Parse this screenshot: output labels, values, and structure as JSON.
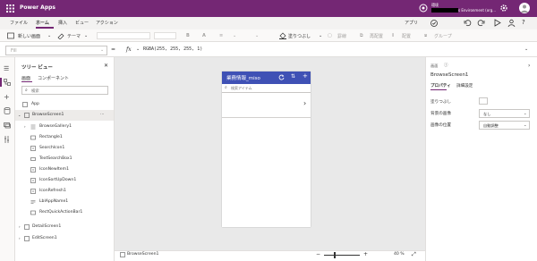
{
  "app": {
    "name": "Power Apps"
  },
  "environment": {
    "label": "環境",
    "name": "s Environment (org..."
  },
  "menu": {
    "items": [
      "ファイル",
      "ホーム",
      "挿入",
      "ビュー",
      "アクション"
    ],
    "right_label": "アプリ"
  },
  "toolbar": {
    "new_screen": "新しい画面",
    "theme": "テーマ",
    "fill": "塗りつぶし",
    "border": "罫線",
    "reorder": "再配置",
    "align": "配置",
    "group": "グループ"
  },
  "formula": {
    "property": "Fill",
    "fx": "fx",
    "value": "RGBA(255, 255, 255, 1)"
  },
  "tree": {
    "title": "ツリー ビュー",
    "tabs": [
      "画面",
      "コンポーネント"
    ],
    "search_placeholder": "検索",
    "app_label": "App",
    "nodes": [
      {
        "label": "BrowseScreen1",
        "icon": "screen-icon"
      },
      {
        "label": "BrowseGallery1",
        "icon": "gallery-icon"
      },
      {
        "label": "Rectangle1",
        "icon": "rectangle-icon"
      },
      {
        "label": "SearchIcon1",
        "icon": "icon-control-icon"
      },
      {
        "label": "TextSearchBox1",
        "icon": "textbox-icon"
      },
      {
        "label": "IconNewItem1",
        "icon": "icon-control-icon"
      },
      {
        "label": "IconSortUpDown1",
        "icon": "icon-control-icon"
      },
      {
        "label": "IconRefresh1",
        "icon": "icon-control-icon"
      },
      {
        "label": "LblAppName1",
        "icon": "label-icon"
      },
      {
        "label": "RectQuickActionBar1",
        "icon": "rectangle-icon"
      },
      {
        "label": "DetailScreen1",
        "icon": "screen-icon"
      },
      {
        "label": "EditScreen1",
        "icon": "screen-icon"
      }
    ]
  },
  "canvas": {
    "app_title": "業務情報_miso",
    "search_placeholder": "検索アイテム",
    "zoom": "40 %",
    "status_screen": "BrowseScreen1"
  },
  "properties": {
    "section": "画面",
    "screen_name": "BrowseScreen1",
    "tabs": [
      "プロパティ",
      "詳細設定"
    ],
    "rows": [
      {
        "label": "塗りつぶし",
        "value": ""
      },
      {
        "label": "背景の画像",
        "value": "なし"
      },
      {
        "label": "画像の位置",
        "value": "自動調整"
      }
    ]
  },
  "colors": {
    "brand": "#742774",
    "app_header": "#3f51b5"
  }
}
